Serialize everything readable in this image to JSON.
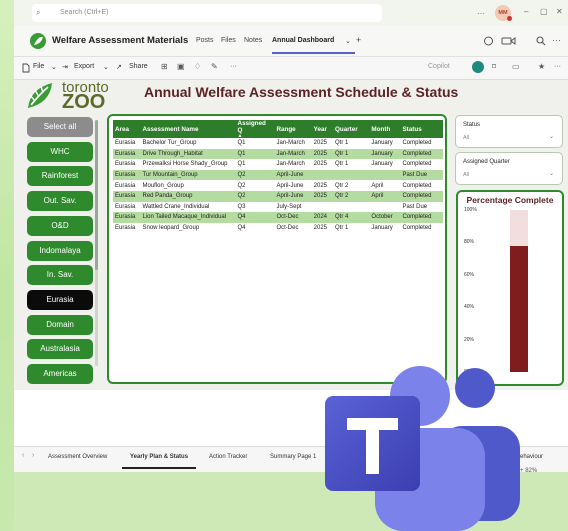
{
  "teams_header": {
    "search_placeholder": "Search (Ctrl+E)",
    "more": "···",
    "avatar_initials": "MM",
    "minimize": "–",
    "maximize": "▢",
    "close": "✕"
  },
  "channel": {
    "title": "Welfare Assessment Materials",
    "tabs": [
      "Posts",
      "Files",
      "Notes",
      "Annual Dashboard"
    ],
    "active_tab": "Annual Dashboard",
    "tab_chevron": "⌄",
    "add_tab": "+",
    "right_icons": [
      "chat-icon",
      "video-icon",
      "search-icon",
      "more-icon"
    ],
    "more": "···"
  },
  "pbi_toolbar": {
    "file_label": "File",
    "export_label": "Export",
    "share_label": "Share",
    "copilot_label": "Copilot",
    "more": "···"
  },
  "report": {
    "logo_top": "toronto",
    "logo_bottom": "ZOO",
    "title": "Annual Welfare Assessment Schedule & Status"
  },
  "slicer_buttons": [
    {
      "label": "Select all",
      "state": "select"
    },
    {
      "label": "WHC",
      "state": "normal"
    },
    {
      "label": "Rainforest",
      "state": "normal"
    },
    {
      "label": "Out. Sav.",
      "state": "normal"
    },
    {
      "label": "O&D",
      "state": "normal"
    },
    {
      "label": "Indomalaya",
      "state": "normal"
    },
    {
      "label": "In. Sav.",
      "state": "normal"
    },
    {
      "label": "Eurasia",
      "state": "active"
    },
    {
      "label": "Domain",
      "state": "normal"
    },
    {
      "label": "Australasia",
      "state": "normal"
    },
    {
      "label": "Americas",
      "state": "normal"
    }
  ],
  "schedule_table": {
    "columns": [
      "Area",
      "Assessment Name",
      "Assigned Q",
      "Range",
      "Year",
      "Quarter",
      "Month",
      "Status"
    ],
    "rows": [
      [
        "Eurasia",
        "Bachelor Tur_Group",
        "Q1",
        "Jan-March",
        "2025",
        "Qtr 1",
        "January",
        "Completed"
      ],
      [
        "Eurasia",
        "Drive Through_Habitat",
        "Q1",
        "Jan-March",
        "2025",
        "Qtr 1",
        "January",
        "Completed"
      ],
      [
        "Eurasia",
        "Przewalksi Horse Shady_Group",
        "Q1",
        "Jan-March",
        "2025",
        "Qtr 1",
        "January",
        "Completed"
      ],
      [
        "Eurasia",
        "Tur Mountain_Group",
        "Q2",
        "April-June",
        "",
        "",
        "",
        "Past Due"
      ],
      [
        "Eurasia",
        "Mouflon_Group",
        "Q2",
        "April-June",
        "2025",
        "Qtr 2",
        "April",
        "Completed"
      ],
      [
        "Eurasia",
        "Red Panda_Group",
        "Q2",
        "April-June",
        "2025",
        "Qtr 2",
        "April",
        "Completed"
      ],
      [
        "Eurasia",
        "Wattled Crane_Individual",
        "Q3",
        "July-Sept",
        "",
        "",
        "",
        "Past Due"
      ],
      [
        "Eurasia",
        "Lion Tailed Macaque_Individual",
        "Q4",
        "Oct-Dec",
        "2024",
        "Qtr 4",
        "October",
        "Completed"
      ],
      [
        "Eurasia",
        "Snow leopard_Group",
        "Q4",
        "Oct-Dec",
        "2025",
        "Qtr 1",
        "January",
        "Completed"
      ]
    ]
  },
  "status_slicer": {
    "label": "Status",
    "value": "All"
  },
  "quarter_slicer": {
    "label": "Assigned Quarter",
    "value": "All"
  },
  "chart_data": {
    "type": "bar",
    "title": "Percentage Complete",
    "categories": [
      ""
    ],
    "values": [
      78
    ],
    "ylim": [
      0,
      100
    ],
    "ytick_labels": [
      "100%",
      "80%",
      "60%",
      "40%",
      "20%",
      "0%"
    ],
    "bar_color": "#7f1c1e",
    "background_color": "#f2dede"
  },
  "page_tabs": {
    "tabs": [
      "Assessment Overview",
      "Yearly Plan & Status",
      "Action Tracker",
      "Summary Page 1",
      "ic Behaviour"
    ],
    "active": "Yearly Plan & Status",
    "zoom_minus": "–",
    "zoom_plus": "+",
    "zoom_level": "82%"
  },
  "colors": {
    "slicer_green": "#2e8a2c",
    "title_maroon": "#5c2326",
    "row_alt_green": "#b4dba0"
  }
}
